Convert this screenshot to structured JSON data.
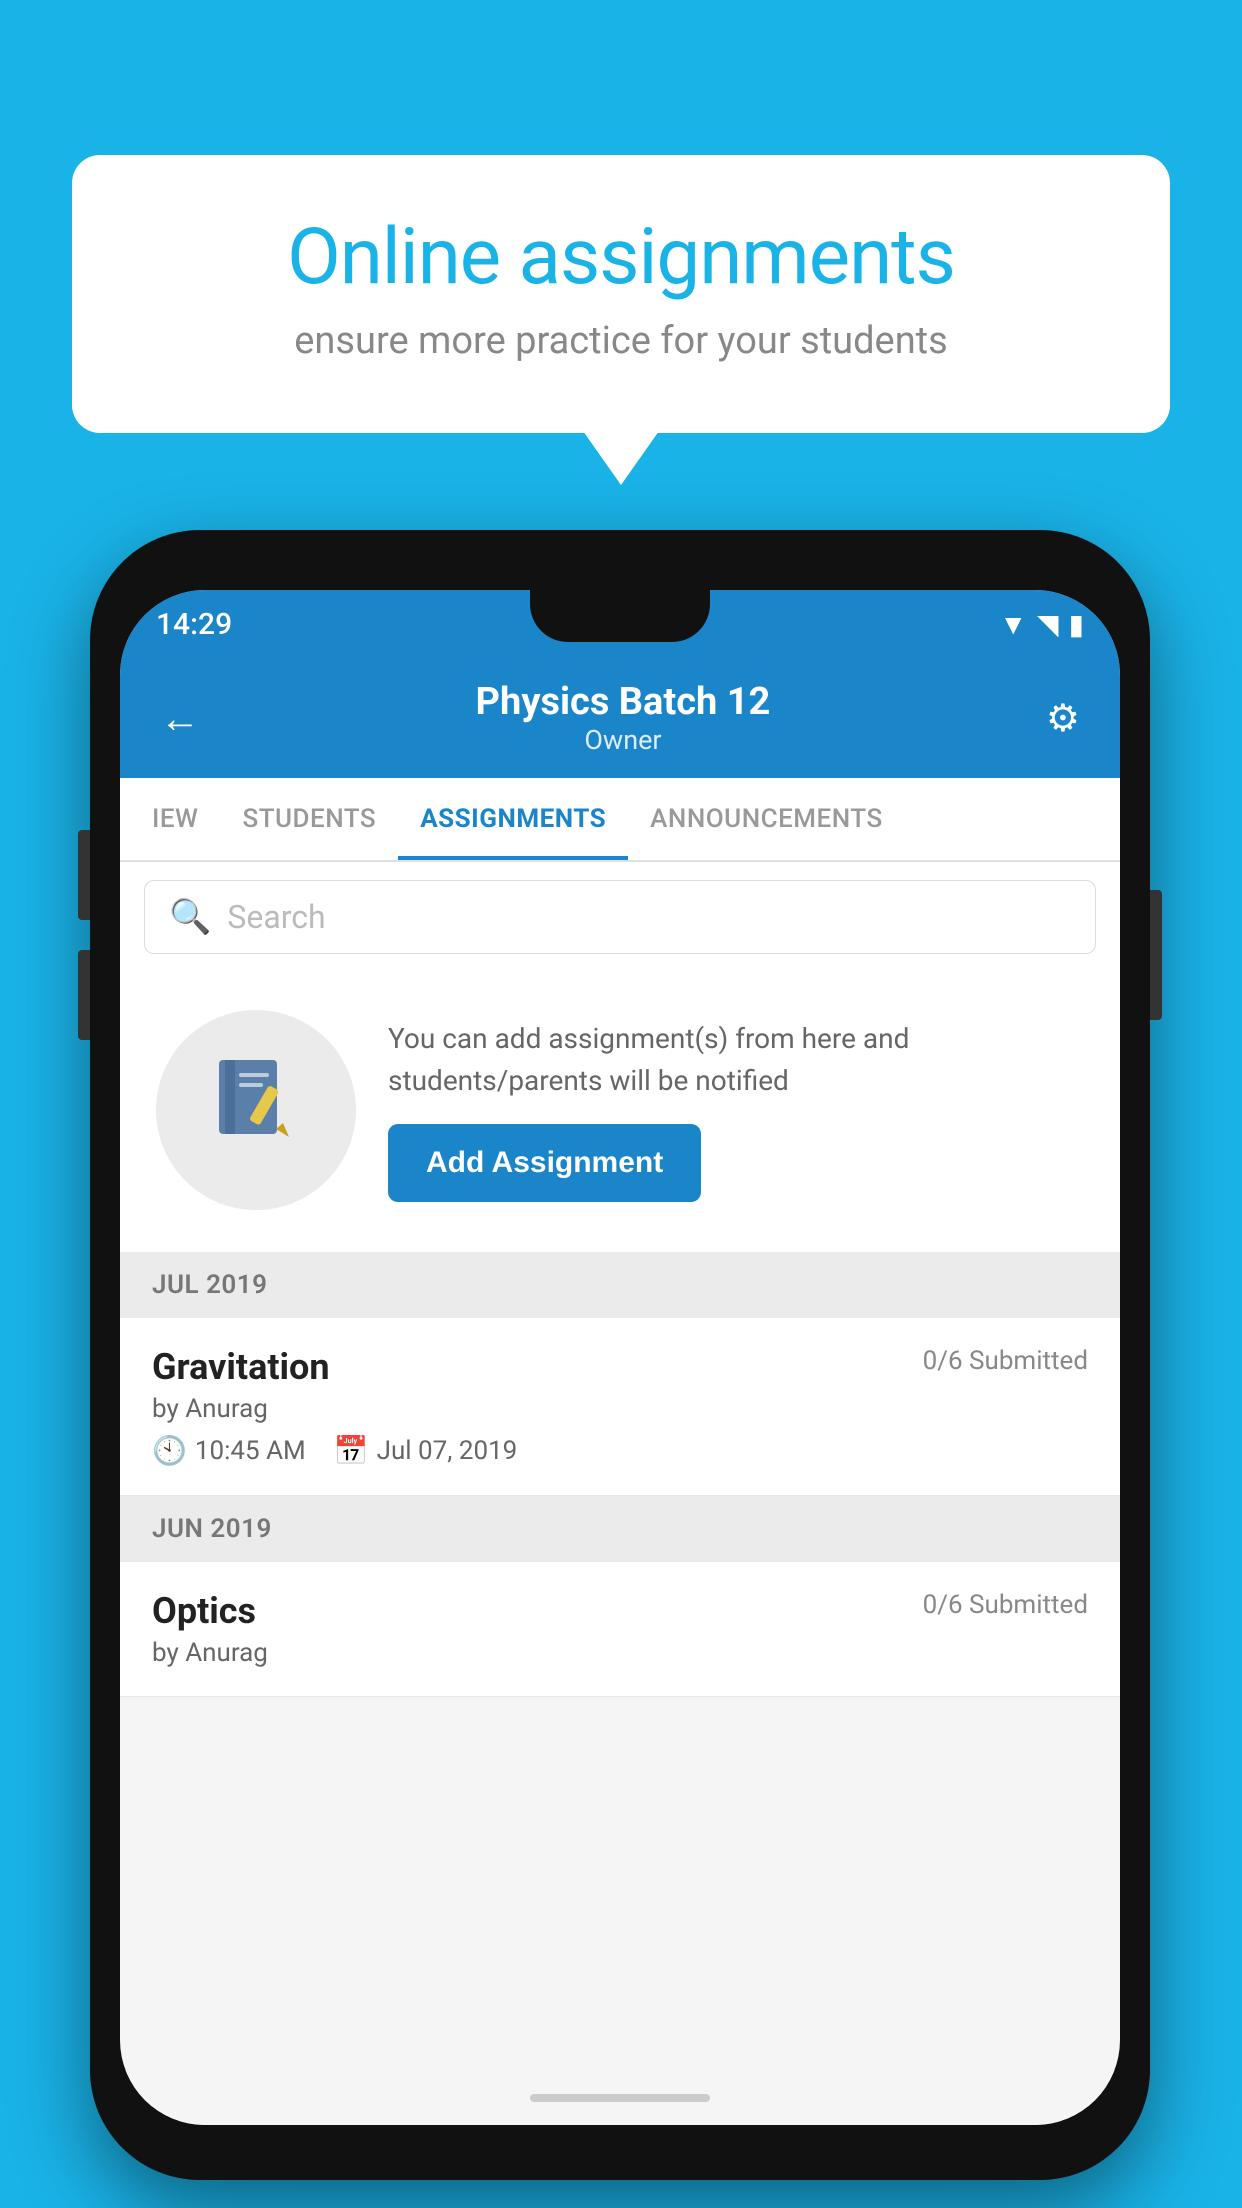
{
  "background_color": "#1ab3e8",
  "speech_bubble": {
    "title": "Online assignments",
    "subtitle": "ensure more practice for your students"
  },
  "status_bar": {
    "time": "14:29",
    "icons": [
      "wifi",
      "signal",
      "battery"
    ]
  },
  "header": {
    "title": "Physics Batch 12",
    "subtitle": "Owner",
    "back_label": "←",
    "gear_label": "⚙"
  },
  "tabs": [
    {
      "label": "IEW",
      "active": false
    },
    {
      "label": "STUDENTS",
      "active": false
    },
    {
      "label": "ASSIGNMENTS",
      "active": true
    },
    {
      "label": "ANNOUNCEMENTS",
      "active": false
    }
  ],
  "search": {
    "placeholder": "Search"
  },
  "add_prompt": {
    "icon": "📓",
    "description": "You can add assignment(s) from here and students/parents will be notified",
    "button_label": "Add Assignment"
  },
  "month_sections": [
    {
      "month_label": "JUL 2019",
      "assignments": [
        {
          "title": "Gravitation",
          "submitted": "0/6 Submitted",
          "author": "by Anurag",
          "time": "10:45 AM",
          "date": "Jul 07, 2019"
        }
      ]
    },
    {
      "month_label": "JUN 2019",
      "assignments": [
        {
          "title": "Optics",
          "submitted": "0/6 Submitted",
          "author": "by Anurag",
          "time": "",
          "date": ""
        }
      ]
    }
  ]
}
